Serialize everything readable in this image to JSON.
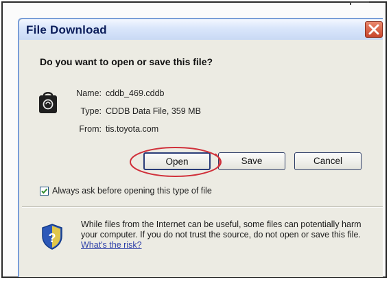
{
  "dialog": {
    "title": "File Download",
    "question": "Do you want to open or save this file?",
    "file": {
      "name_label": "Name:",
      "name_value": "cddb_469.cddb",
      "type_label": "Type:",
      "type_value": "CDDB Data File, 359 MB",
      "from_label": "From:",
      "from_value": "tis.toyota.com"
    },
    "buttons": {
      "open": "Open",
      "save": "Save",
      "cancel": "Cancel"
    },
    "always_ask": {
      "label": "Always ask before opening this type of file",
      "checked": true
    },
    "warning": {
      "text": "While files from the Internet can be useful, some files can potentially harm your computer. If you do not trust the source, do not open or save this file.",
      "link": "What's the risk?"
    }
  },
  "colors": {
    "title_text": "#0b1d5a",
    "dialog_bg": "#ecebe3",
    "close_button": "#c8452c",
    "annotation_circle": "#d0303a",
    "link": "#2d3fa8"
  },
  "icons": [
    "file-type-icon",
    "close-icon",
    "check-icon",
    "shield-icon"
  ]
}
